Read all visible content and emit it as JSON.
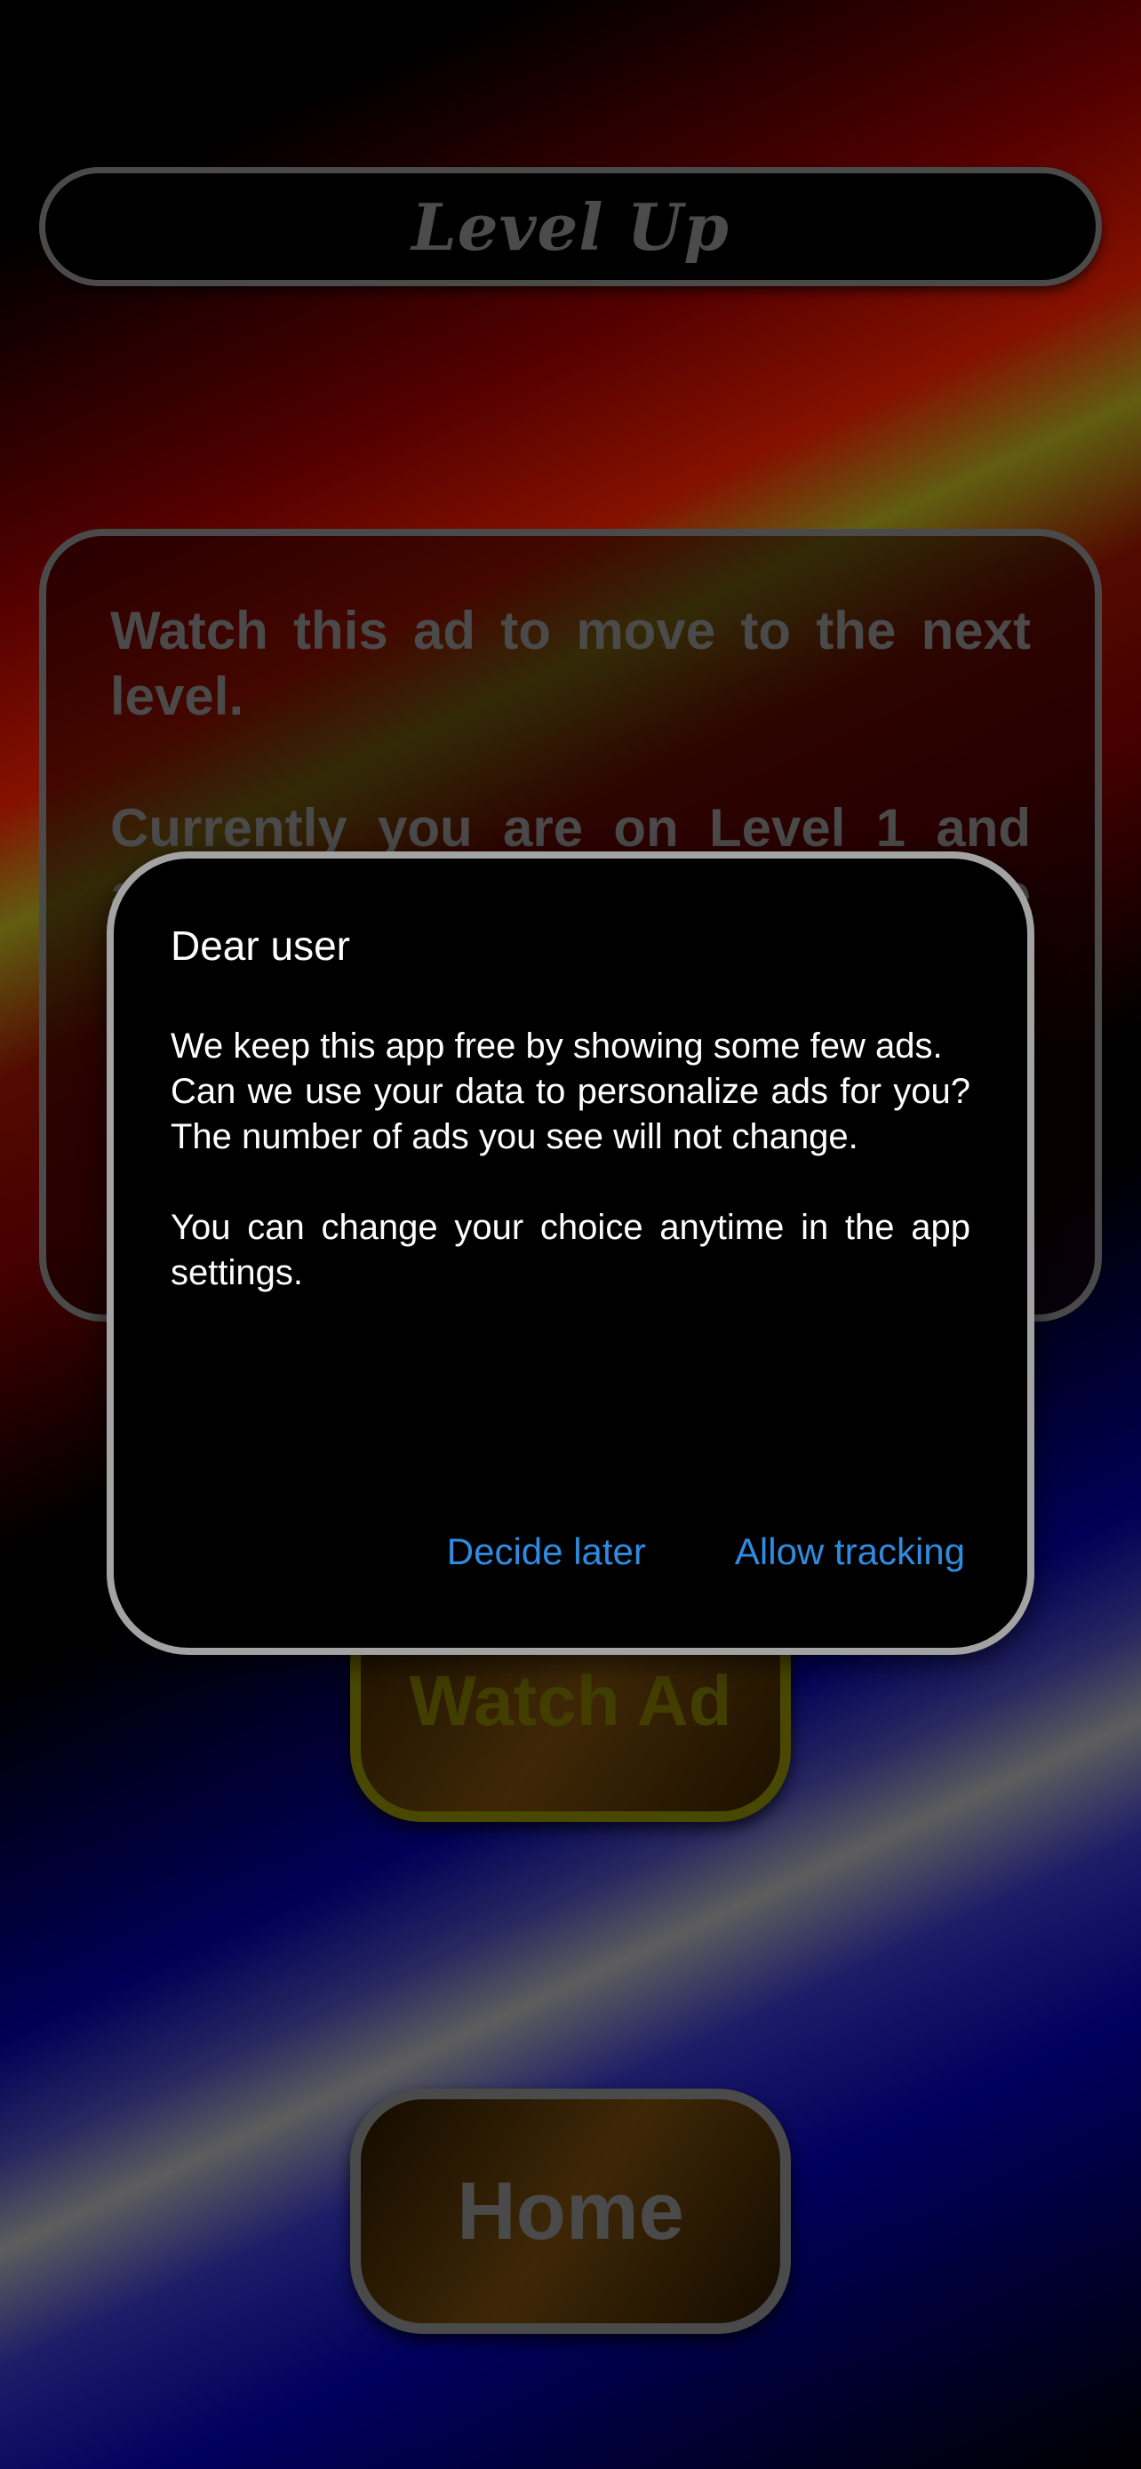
{
  "header": {
    "title": "Level Up"
  },
  "info_card": {
    "text": "Watch this ad to move to the next level.\n\nCurrently you are on Level 1 and after watching the ad you will move to Level 2.\n\nYou can watch as many ads as you like to level up."
  },
  "buttons": {
    "watch_ad": "Watch Ad",
    "home": "Home"
  },
  "dialog": {
    "title": "Dear user",
    "body": "We keep this app free by showing some few ads.\nCan we use your data to personalize ads for you? The number of ads you see will not change.\n\nYou can change your choice anytime in the app settings.",
    "decide_later": "Decide later",
    "allow_tracking": "Allow tracking"
  },
  "colors": {
    "dialog_action": "#2f8be0",
    "watch_border": "#6c6a00",
    "frame_gray": "#6e6e6e"
  }
}
